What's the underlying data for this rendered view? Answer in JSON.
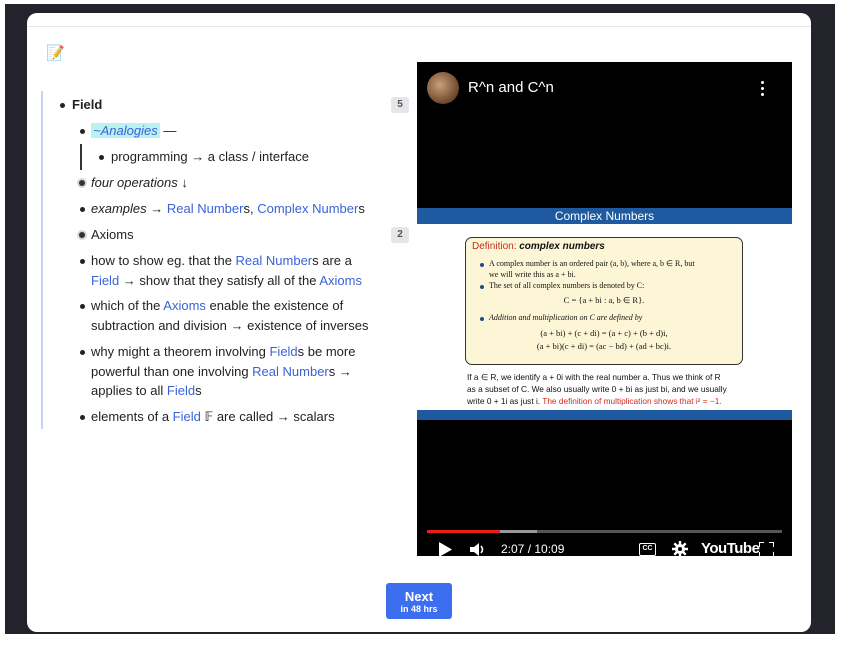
{
  "memo_icon": "memo-icon",
  "outline": {
    "root": {
      "label": "Field",
      "badge": "5"
    },
    "analogies": {
      "label": "~Analogies",
      "suffix": " —"
    },
    "programming": {
      "text": "programming → a class / interface"
    },
    "four_ops": {
      "text": "four operations ↓"
    },
    "examples": {
      "prefix": "examples",
      "arrow": " → ",
      "link1": "Real Number",
      "s1": "s, ",
      "link2": "Complex Number",
      "s2": "s"
    },
    "axioms": {
      "label": "Axioms",
      "badge": "2"
    },
    "show": {
      "t1": "how to show eg. that the ",
      "l1": "Real Number",
      "t2": "s are a",
      "l2": "Field",
      "t3": " → show that they satisfy all of the ",
      "l3": "Axioms"
    },
    "which": {
      "t1": "which of the ",
      "l1": "Axioms",
      "t2": " enable the existence of",
      "line2": "subtraction and division → existence of inverses"
    },
    "why": {
      "t1": "why might a theorem involving ",
      "l1": "Field",
      "t2": "s be more",
      "t3": "powerful than one involving ",
      "l2": "Real Number",
      "t4": "s →",
      "t5": "applies to all ",
      "l3": "Field",
      "t6": "s"
    },
    "elements": {
      "t1": "elements of a ",
      "l1": "Field",
      "t2": " 𝔽 are called → scalars"
    }
  },
  "video": {
    "title": "R^n and C^n",
    "slide": {
      "heading": "Complex Numbers",
      "def_label": "Definition:",
      "def_title": "complex numbers",
      "b1a": "A complex number is an ordered pair (a, b), where a, b ∈ R, but",
      "b1b": "we will write this as a + bi.",
      "b2": "The set of all complex numbers is denoted by C:",
      "eq1": "C = {a + bi : a, b ∈ R}.",
      "b3": "Addition and multiplication on C are defined by",
      "eq2": "(a + bi) + (c + di) = (a + c) + (b + d)i,",
      "eq3": "(a + bi)(c + di) = (ac − bd) + (ad + bc)i.",
      "f1": "If a ∈ R, we identify a + 0i with the real number a. Thus we think of R",
      "f2": "as a subset of C. We also usually write 0 + bi as just bi, and we usually",
      "f3a": "write 0 + 1i as just i. ",
      "f3b": "The definition of multiplication shows that i² = −1."
    },
    "progress": 0.207,
    "buffered": 0.31,
    "time": "2:07 / 10:09",
    "cc": "CC",
    "brand": "YouTube"
  },
  "next": {
    "label": "Next",
    "sub": "in 48 hrs"
  }
}
